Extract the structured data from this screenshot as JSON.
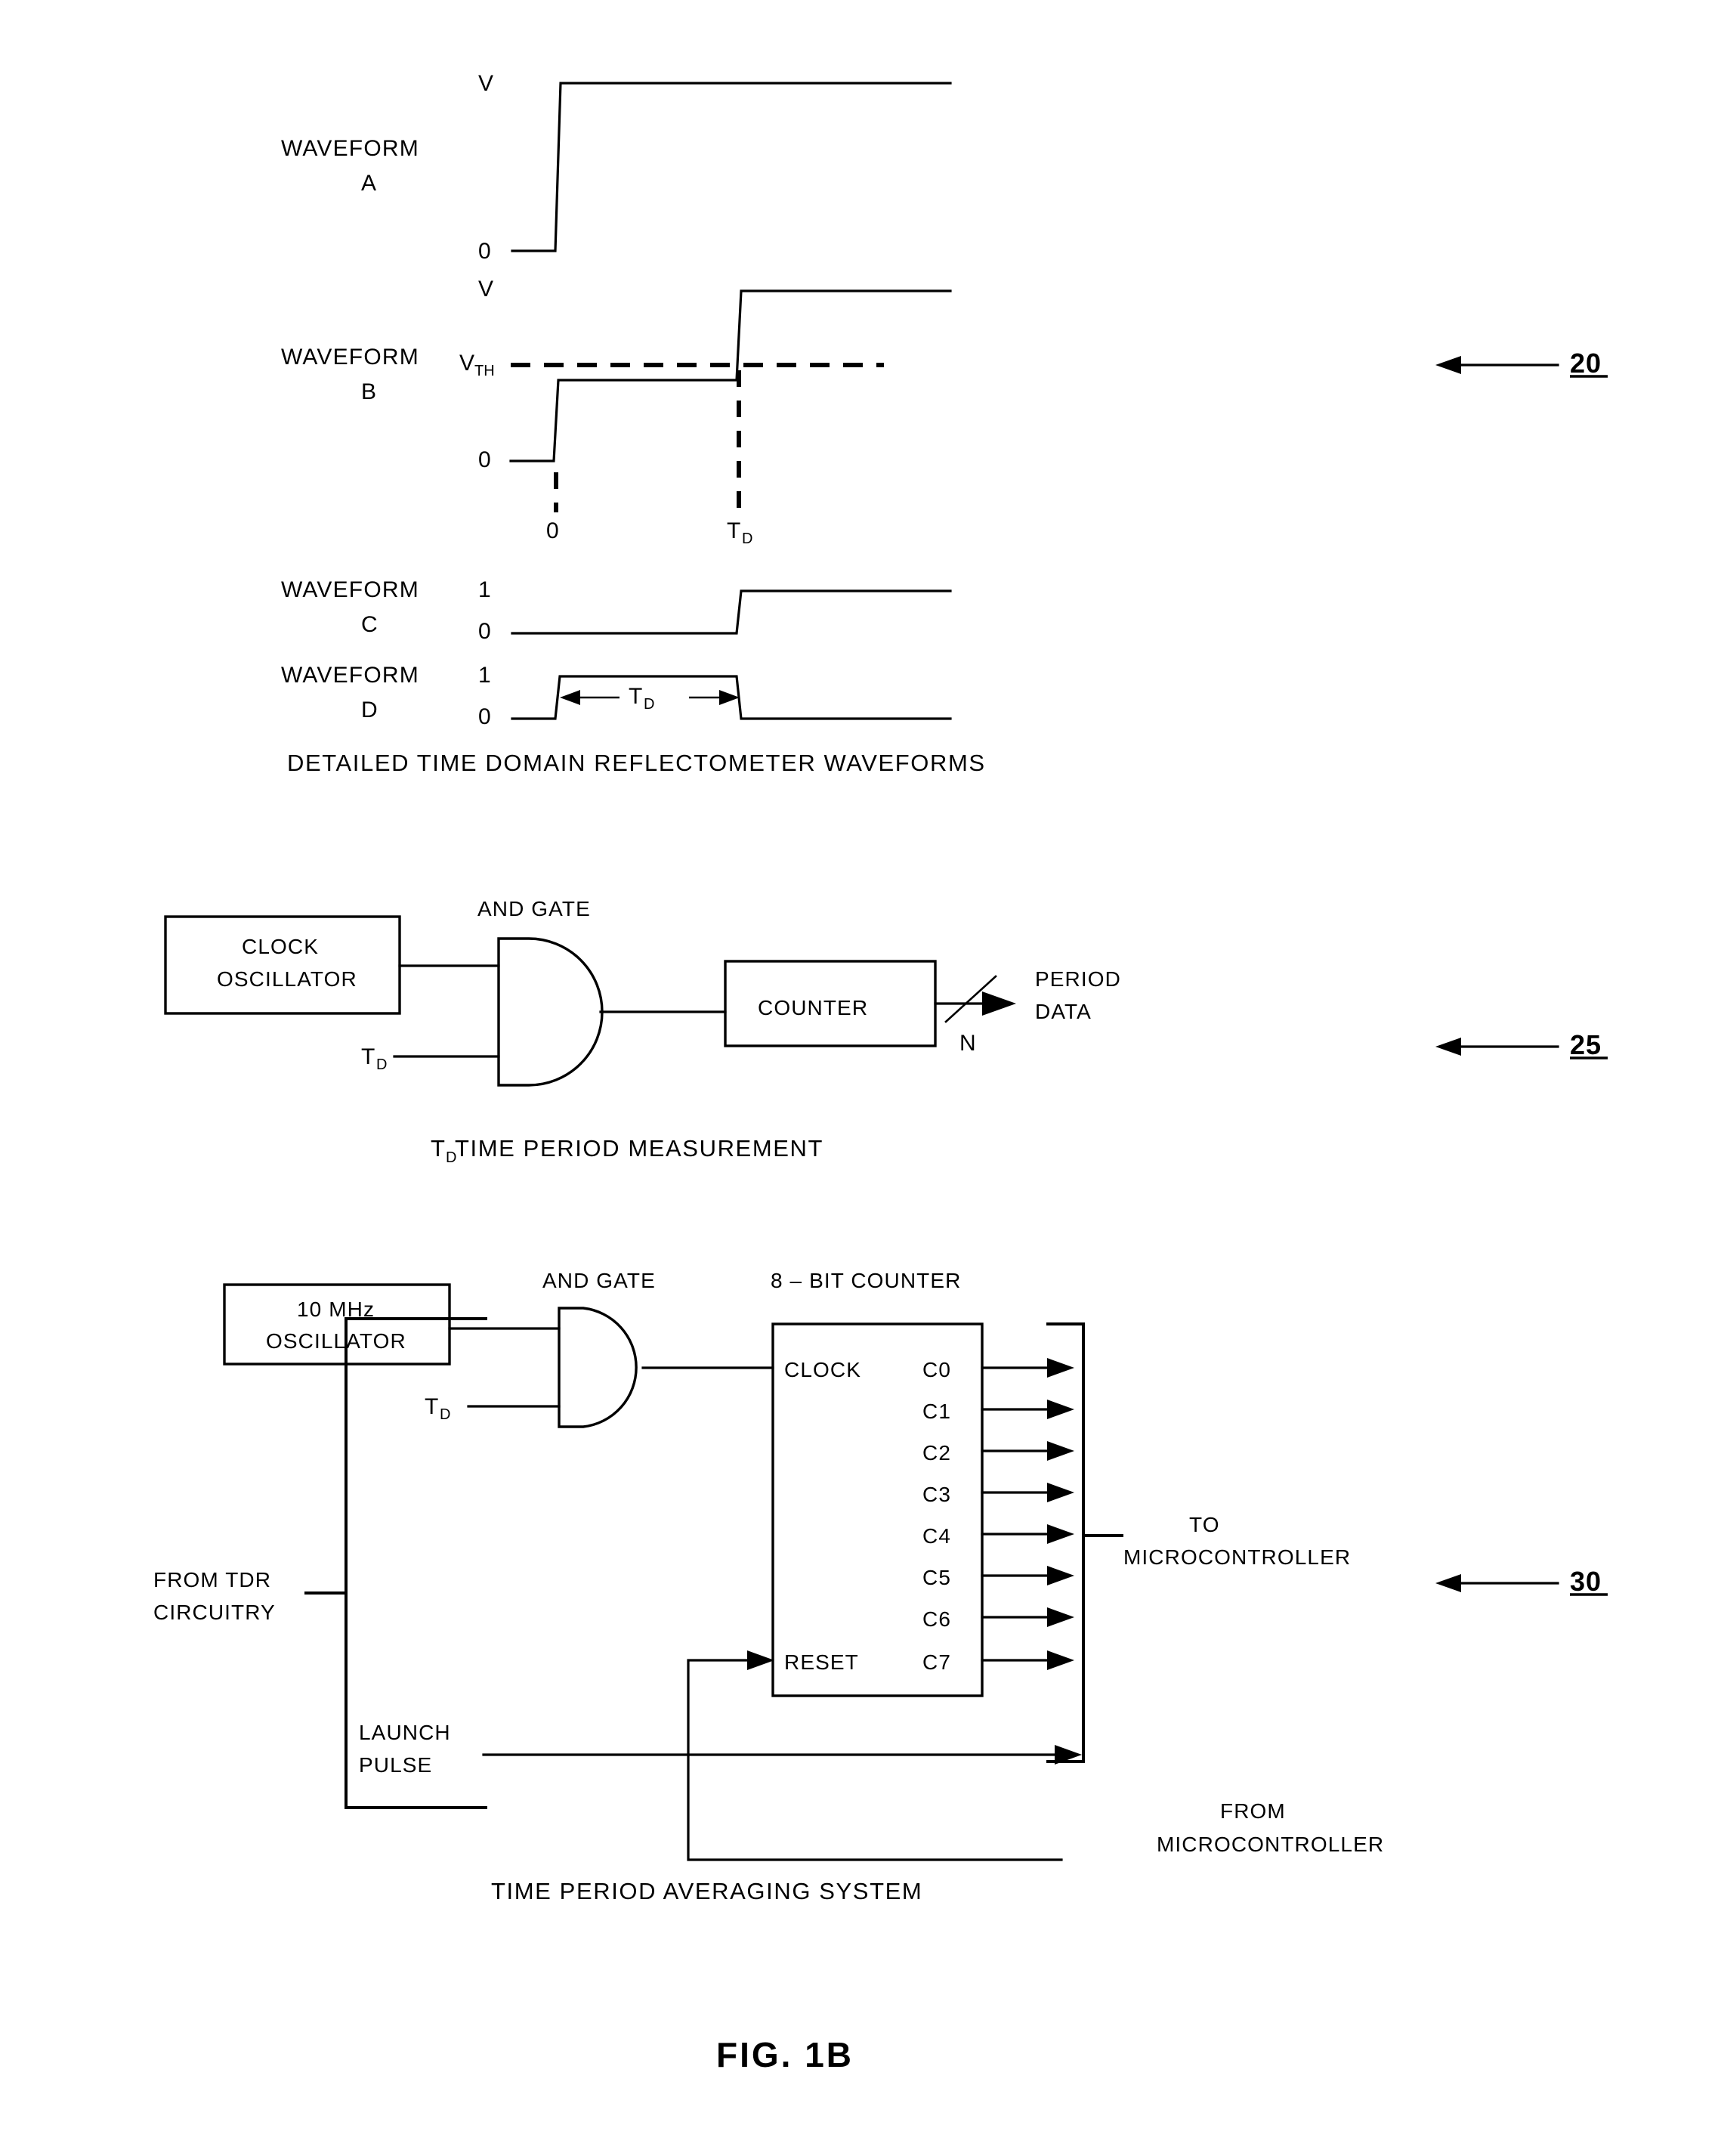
{
  "figure": {
    "title": "FIG. 1B"
  },
  "panel_waveforms": {
    "reference_number": "20",
    "caption": "DETAILED TIME DOMAIN REFLECTOMETER WAVEFORMS",
    "waveforms": [
      {
        "name_line1": "WAVEFORM",
        "name_line2": "A",
        "high_label": "V",
        "low_label": "0",
        "transition": "rising edge at t=0 from 0 to V"
      },
      {
        "name_line1": "WAVEFORM",
        "name_line2": "B",
        "high_label": "V",
        "threshold_label": "V",
        "threshold_sub": "TH",
        "low_label": "0",
        "time_origin_label": "0",
        "time_delay_label": "T",
        "time_delay_sub": "D",
        "transition": "rises to just below VTH at t=0, then steps above V at t=TD"
      },
      {
        "name_line1": "WAVEFORM",
        "name_line2": "C",
        "high_label": "1",
        "low_label": "0",
        "transition": "rises from 0 to 1 at t=TD"
      },
      {
        "name_line1": "WAVEFORM",
        "name_line2": "D",
        "high_label": "1",
        "low_label": "0",
        "pulse_label": "T",
        "pulse_sub": "D",
        "transition": "pulse high from t=0 to t=TD"
      }
    ]
  },
  "panel_measurement": {
    "reference_number": "25",
    "caption_prefix": "T",
    "caption_sub": "D",
    "caption_rest": " TIME PERIOD MEASUREMENT",
    "clock_block_line1": "CLOCK",
    "clock_block_line2": "OSCILLATOR",
    "and_gate_label": "AND GATE",
    "td_input_label": "T",
    "td_input_sub": "D",
    "counter_block": "COUNTER",
    "bus_width_label": "N",
    "output_line1": "PERIOD",
    "output_line2": "DATA"
  },
  "panel_averaging": {
    "reference_number": "30",
    "caption": "TIME PERIOD AVERAGING SYSTEM",
    "oscillator_line1": "10 MHz",
    "oscillator_line2": "OSCILLATOR",
    "and_gate_label": "AND GATE",
    "td_input_label": "T",
    "td_input_sub": "D",
    "counter_title": "8 – BIT COUNTER",
    "counter_clock_pin": "CLOCK",
    "counter_reset_pin": "RESET",
    "counter_outputs": [
      "C0",
      "C1",
      "C2",
      "C3",
      "C4",
      "C5",
      "C6",
      "C7"
    ],
    "source_line1": "FROM TDR",
    "source_line2": "CIRCUITRY",
    "launch_line1": "LAUNCH",
    "launch_line2": "PULSE",
    "to_mcu_line1": "TO",
    "to_mcu_line2": "MICROCONTROLLER",
    "from_mcu_line1": "FROM",
    "from_mcu_line2": "MICROCONTROLLER"
  }
}
